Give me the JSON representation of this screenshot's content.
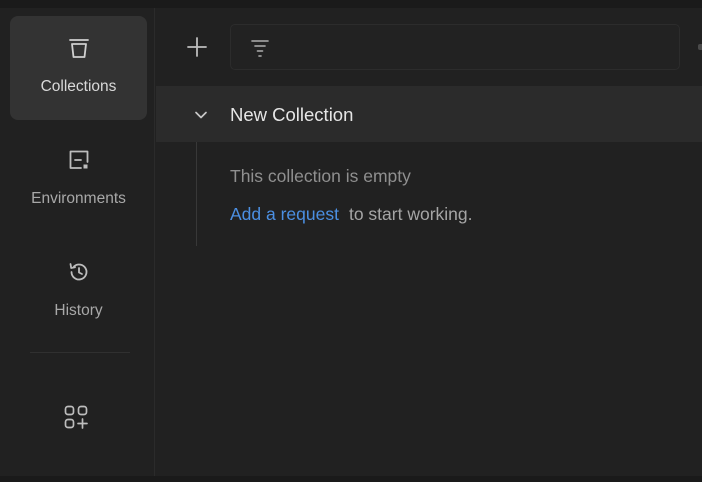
{
  "sidebar": {
    "items": [
      {
        "label": "Collections",
        "icon": "trash-can-icon",
        "active": true
      },
      {
        "label": "Environments",
        "icon": "environment-icon",
        "active": false
      },
      {
        "label": "History",
        "icon": "history-icon",
        "active": false
      }
    ],
    "apps_icon": "apps-add-icon"
  },
  "toolbar": {
    "add_icon": "plus-icon",
    "filter_icon": "filter-icon",
    "filter_value": "",
    "filter_placeholder": ""
  },
  "collection": {
    "name": "New Collection",
    "expanded": true,
    "empty_text": "This collection is empty",
    "add_request_link": "Add a request",
    "add_request_rest": "to start working."
  },
  "colors": {
    "background": "#212121",
    "sidebar_active": "#333333",
    "collection_header": "#2b2b2b",
    "link": "#4b8fe2",
    "muted_text": "#8f8f8f"
  }
}
